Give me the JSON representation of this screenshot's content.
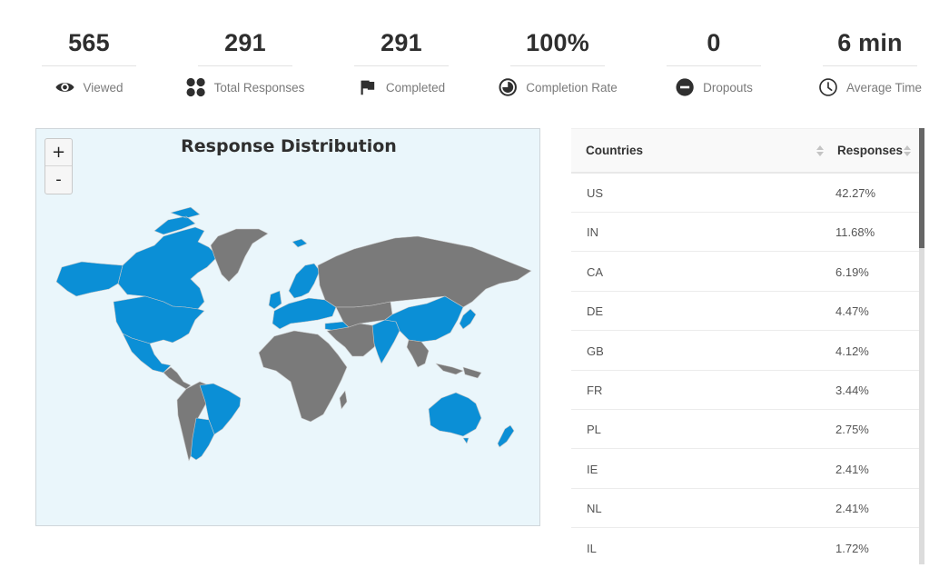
{
  "stats": [
    {
      "value": "565",
      "label": "Viewed",
      "icon": "eye-icon"
    },
    {
      "value": "291",
      "label": "Total Responses",
      "icon": "grid-dots-icon"
    },
    {
      "value": "291",
      "label": "Completed",
      "icon": "flag-icon"
    },
    {
      "value": "100%",
      "label": "Completion Rate",
      "icon": "pie-progress-icon"
    },
    {
      "value": "0",
      "label": "Dropouts",
      "icon": "minus-circle-icon"
    },
    {
      "value": "6 min",
      "label": "Average Time",
      "icon": "clock-icon"
    }
  ],
  "map": {
    "title": "Response Distribution",
    "zoom_in_label": "+",
    "zoom_out_label": "-",
    "colors": {
      "background": "#eaf6fb",
      "responded": "#0b8fd6",
      "no_response": "#7a7a7a",
      "border": "#c8c8c8"
    },
    "highlighted_regions": [
      "US",
      "CA",
      "MX",
      "BR",
      "AR",
      "GB",
      "IE",
      "FR",
      "ES",
      "PT",
      "DE",
      "NL",
      "PL",
      "SE",
      "NO",
      "FI",
      "IT",
      "TR",
      "IN",
      "CN",
      "JP",
      "KR",
      "AU",
      "NZ",
      "IS",
      "GR",
      "RO",
      "UA"
    ]
  },
  "table": {
    "columns": [
      "Countries",
      "Responses"
    ],
    "rows": [
      {
        "country": "US",
        "pct": "42.27%"
      },
      {
        "country": "IN",
        "pct": "11.68%"
      },
      {
        "country": "CA",
        "pct": "6.19%"
      },
      {
        "country": "DE",
        "pct": "4.47%"
      },
      {
        "country": "GB",
        "pct": "4.12%"
      },
      {
        "country": "FR",
        "pct": "3.44%"
      },
      {
        "country": "PL",
        "pct": "2.75%"
      },
      {
        "country": "IE",
        "pct": "2.41%"
      },
      {
        "country": "NL",
        "pct": "2.41%"
      },
      {
        "country": "IL",
        "pct": "1.72%"
      }
    ]
  }
}
